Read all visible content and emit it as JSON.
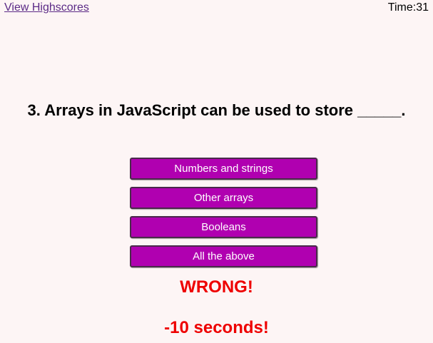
{
  "header": {
    "highscores_link": "View Highscores",
    "timer_label": "Time:31"
  },
  "quiz": {
    "question": "3. Arrays in JavaScript can be used to store _____.",
    "answers": [
      {
        "label": "Numbers and strings"
      },
      {
        "label": "Other arrays"
      },
      {
        "label": "Booleans"
      },
      {
        "label": "All the above"
      }
    ],
    "feedback": "WRONG!",
    "penalty": "-10 seconds!"
  },
  "colors": {
    "background": "#fdf5f5",
    "button": "#b000b0",
    "feedback": "#ee0000",
    "link": "#5b2a86"
  }
}
